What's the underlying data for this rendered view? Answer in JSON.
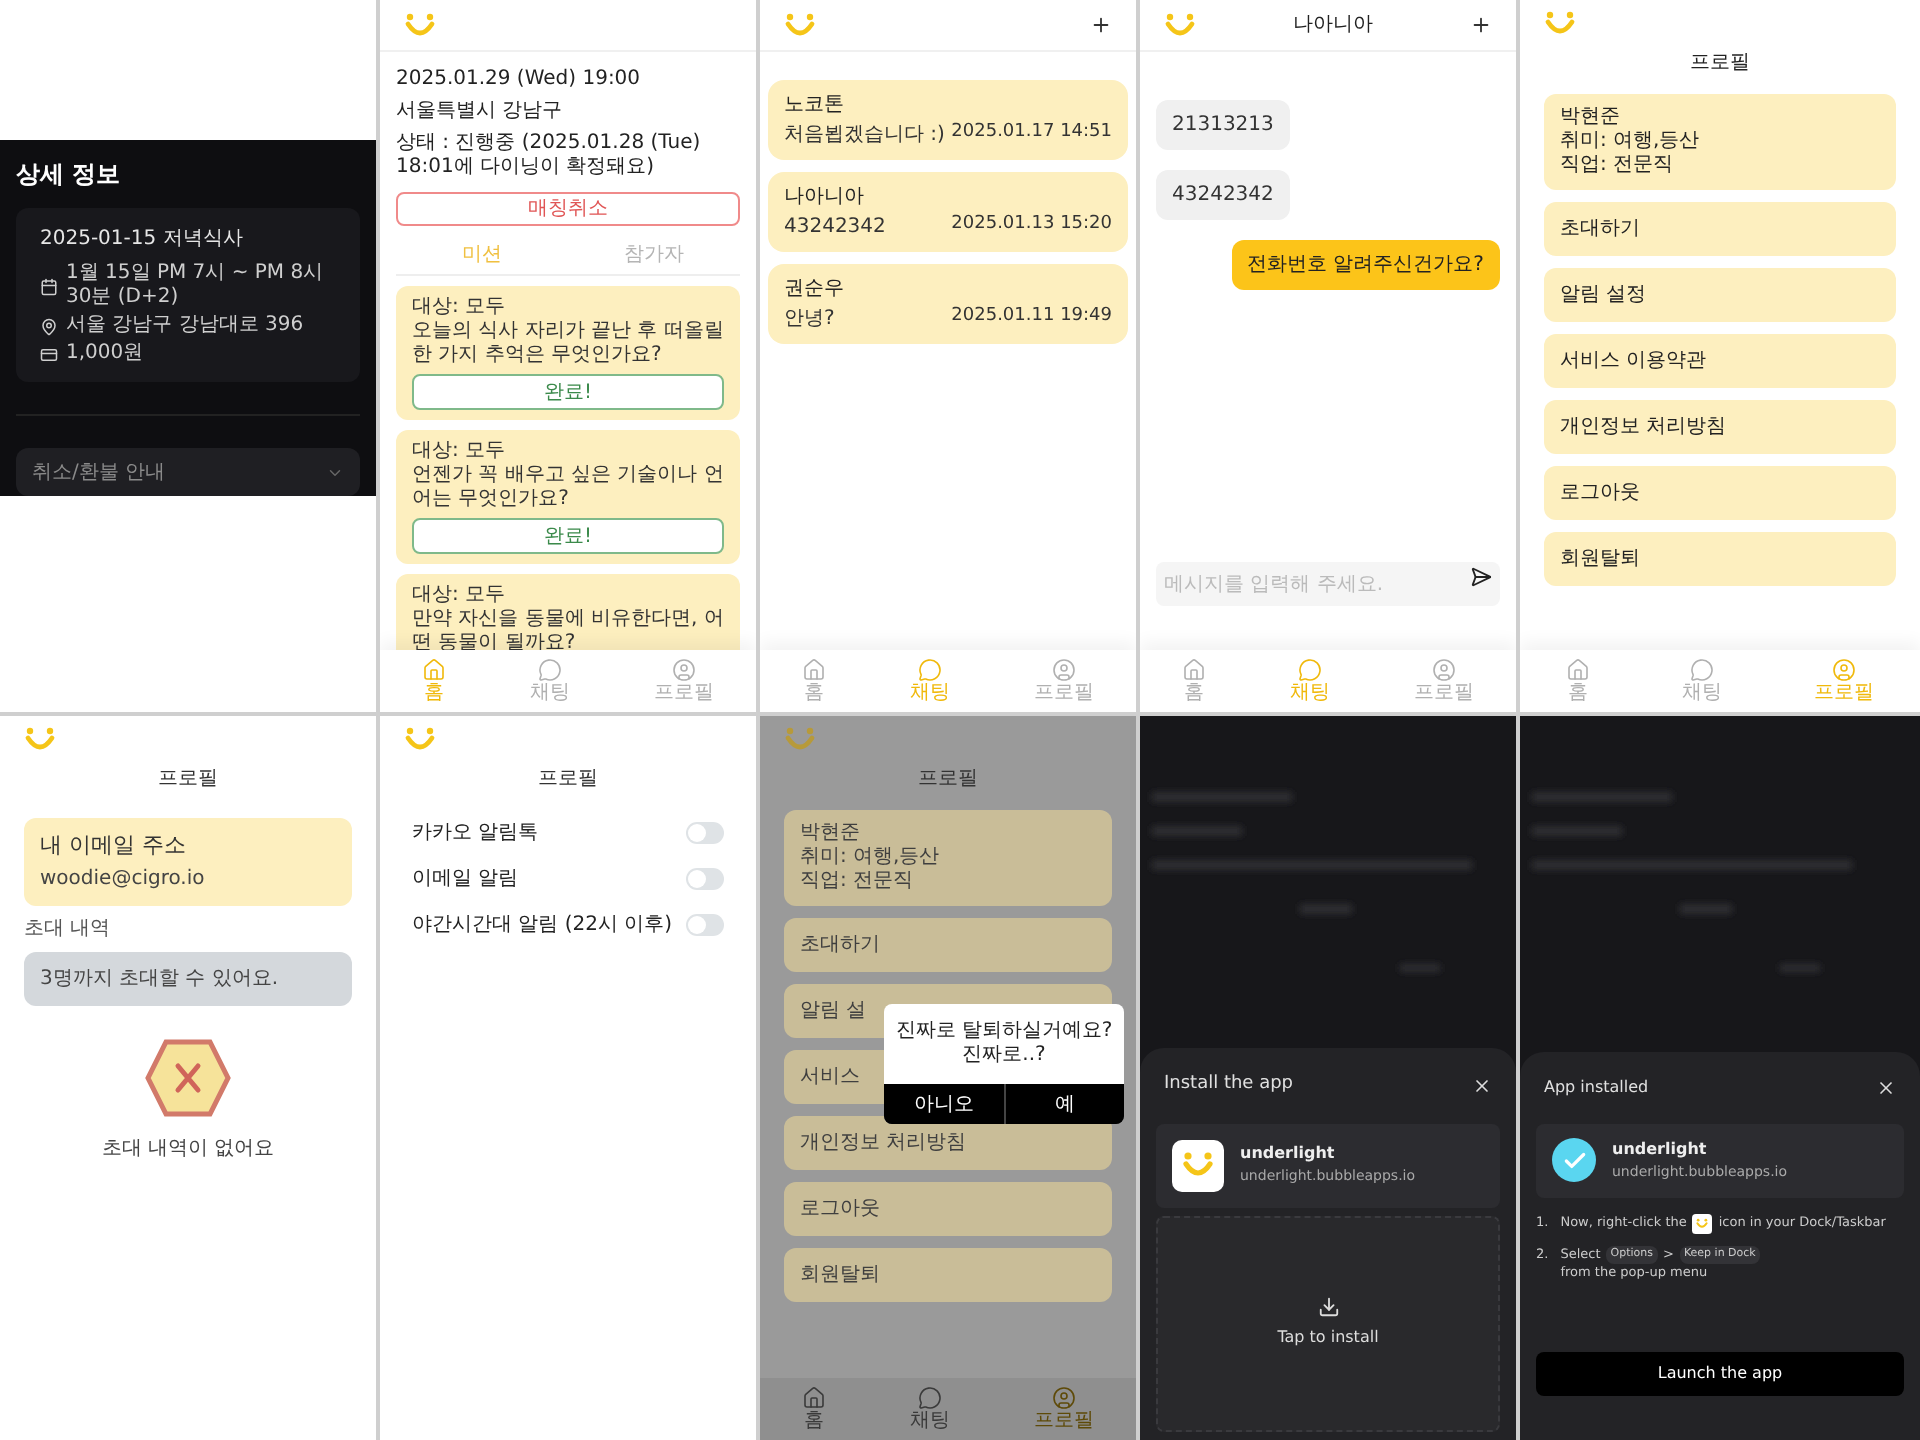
{
  "panels": [
    {
      "kind": "detail_dark",
      "title": "상세 정보",
      "event": "2025-01-15 저녁식사",
      "rows": [
        "1월 15일 PM 7시 ~ PM 8시 30분 (D+2)",
        "서울 강남구 강남대로 396",
        "1,000원"
      ],
      "accordion": "취소/환불 안내"
    },
    {
      "kind": "home",
      "info": [
        "2025.01.29 (Wed) 19:00",
        "서울특별시 강남구",
        "상태 : 진행중 (2025.01.28 (Tue) 18:01에 다이닝이 확정돼요)"
      ],
      "cancel": "매칭취소",
      "tabs": [
        {
          "label": "미션",
          "selected": true
        },
        {
          "label": "참가자",
          "selected": false
        }
      ],
      "missions": [
        {
          "target": "대상: 모두",
          "question": "오늘의 식사 자리가 끝난 후 떠올릴 한 가지 추억은 무엇인가요?",
          "button": "완료!"
        },
        {
          "target": "대상: 모두",
          "question": "언젠가 꼭 배우고 싶은 기술이나 언어는 무엇인가요?",
          "button": "완료!"
        },
        {
          "target": "대상: 모두",
          "question": "만약 자신을 동물에 비유한다면, 어떤 동물이 될까요?"
        }
      ],
      "nav": [
        {
          "label": "홈",
          "selected": true
        },
        {
          "label": "채팅",
          "selected": false
        },
        {
          "label": "프로필",
          "selected": false
        }
      ]
    },
    {
      "kind": "chat_list",
      "chats": [
        {
          "name": "노코톤",
          "message": "처음뵙겠습니다 :)",
          "time": "2025.01.17 14:51"
        },
        {
          "name": "나아니아",
          "message": "43242342",
          "time": "2025.01.13 15:20"
        },
        {
          "name": "권순우",
          "message": "안녕?",
          "time": "2025.01.11 19:49"
        }
      ],
      "nav": [
        {
          "label": "홈",
          "selected": false
        },
        {
          "label": "채팅",
          "selected": true
        },
        {
          "label": "프로필",
          "selected": false
        }
      ]
    },
    {
      "kind": "chat_room",
      "title": "나아니아",
      "messages": [
        {
          "text": "21313213",
          "mine": false
        },
        {
          "text": "43242342",
          "mine": false
        },
        {
          "text": "전화번호 알려주신건가요?",
          "mine": true
        }
      ],
      "input": {
        "placeholder": "메시지를 입력해 주세요."
      },
      "nav": [
        {
          "label": "홈",
          "selected": false
        },
        {
          "label": "채팅",
          "selected": true
        },
        {
          "label": "프로필",
          "selected": false
        }
      ]
    },
    {
      "kind": "profile",
      "title": "프로필",
      "profile": [
        "박현준",
        "취미: 여행,등산",
        "직업: 전문직"
      ],
      "menu": [
        "초대하기",
        "알림 설정",
        "서비스 이용약관",
        "개인정보 처리방침",
        "로그아웃",
        "회원탈퇴"
      ],
      "nav": [
        {
          "label": "홈",
          "selected": false
        },
        {
          "label": "채팅",
          "selected": false
        },
        {
          "label": "프로필",
          "selected": true
        }
      ]
    },
    {
      "kind": "invite",
      "title": "프로필",
      "email_label": "내 이메일 주소",
      "email": "woodie@cigro.io",
      "section": "초대 내역",
      "notice": "3명까지 초대할 수 있어요.",
      "empty": "초대 내역이 없어요"
    },
    {
      "kind": "notifications",
      "title": "프로필",
      "toggles": [
        {
          "label": "카카오 알림톡",
          "on": false
        },
        {
          "label": "이메일 알림",
          "on": false
        },
        {
          "label": "야간시간대 알림 (22시 이후)",
          "on": false
        }
      ]
    },
    {
      "kind": "profile_dialog",
      "title": "프로필",
      "profile": [
        "박현준",
        "취미: 여행,등산",
        "직업: 전문직"
      ],
      "menu": [
        "초대하기",
        "알림 설",
        "서비스",
        "개인정보 처리방침",
        "로그아웃",
        "회원탈퇴"
      ],
      "dialog": {
        "lines": [
          "진짜로 탈퇴하실거예요?",
          "진짜로..?"
        ],
        "buttons": [
          "아니오",
          "예"
        ]
      },
      "nav": [
        {
          "label": "홈",
          "selected": false
        },
        {
          "label": "채팅",
          "selected": false
        },
        {
          "label": "프로필",
          "selected": true
        }
      ]
    },
    {
      "kind": "install",
      "title": "Install the app",
      "app": "underlight",
      "url": "underlight.bubbleapps.io",
      "action": "Tap to install"
    },
    {
      "kind": "installed",
      "title": "App installed",
      "app": "underlight",
      "url": "underlight.bubbleapps.io",
      "steps": [
        {
          "number": "1.",
          "parts": [
            {
              "kind": "text",
              "text": "Now, right-click the"
            },
            {
              "kind": "app_icon"
            },
            {
              "kind": "text",
              "text": "icon in your Dock/Taskbar"
            }
          ]
        },
        {
          "number": "2.",
          "parts": [
            {
              "kind": "text",
              "text": "Select"
            },
            {
              "kind": "chip",
              "text": "Options"
            },
            {
              "kind": "text",
              "text": ">"
            },
            {
              "kind": "chip",
              "text": "Keep in Dock"
            },
            {
              "kind": "text",
              "text": "from the pop-up menu"
            }
          ]
        }
      ],
      "button": "Launch the app"
    }
  ]
}
